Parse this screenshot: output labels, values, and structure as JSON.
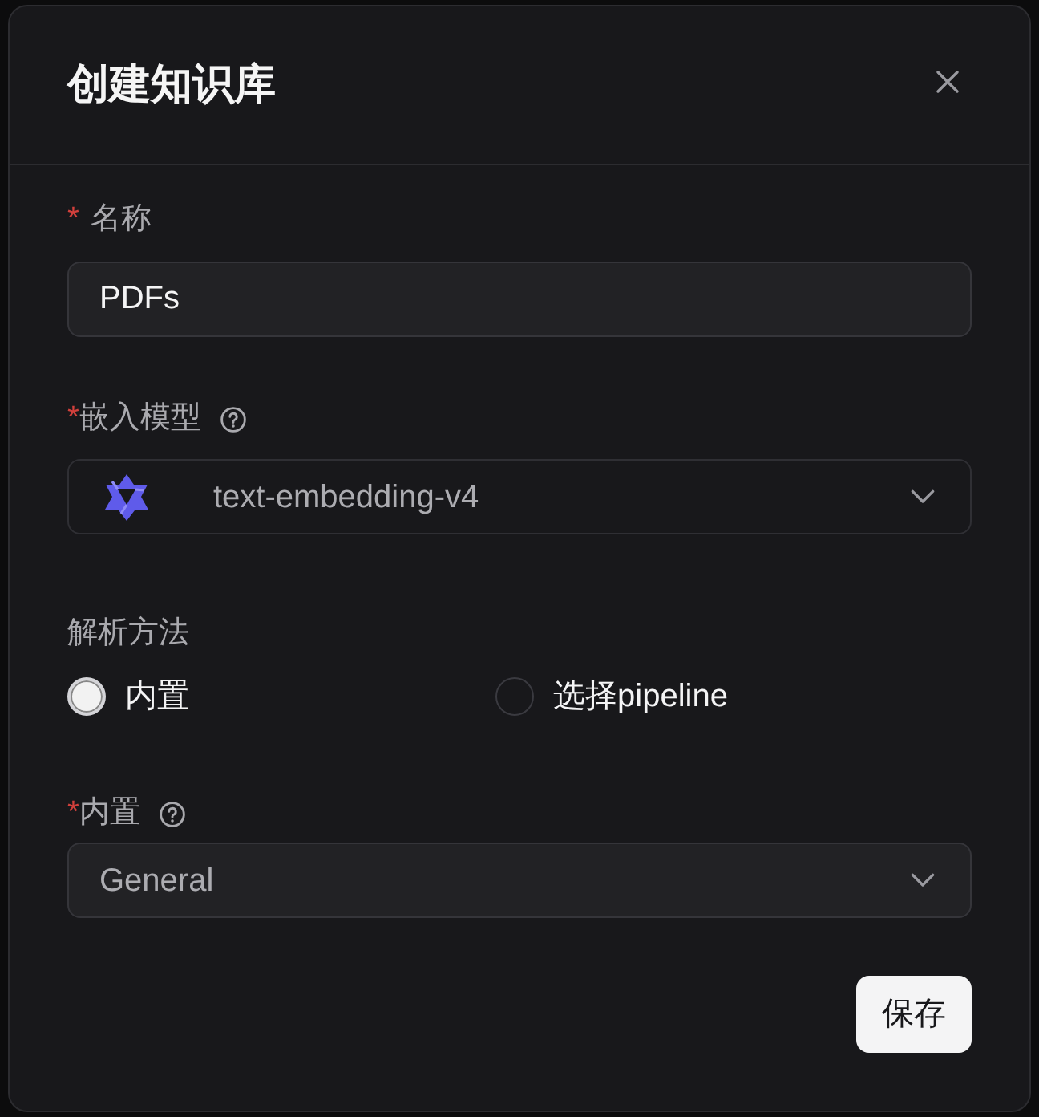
{
  "dialog": {
    "title": "创建知识库"
  },
  "fields": [
    {
      "kind": "text",
      "mark": "*",
      "label": "名称",
      "help": false,
      "value": "PDFs"
    },
    {
      "kind": "model_select",
      "mark": "*",
      "label": "嵌入模型",
      "help": true,
      "value": "text-embedding-v4"
    },
    {
      "kind": "radio",
      "label": "解析方法",
      "help": false,
      "options": [
        {
          "label": "内置",
          "selected": true
        },
        {
          "label": "选择pipeline",
          "selected": false
        }
      ]
    },
    {
      "kind": "select",
      "mark": "*",
      "label": "内置",
      "help": true,
      "value": "General"
    }
  ],
  "buttons": [
    {
      "label": "保存"
    }
  ]
}
